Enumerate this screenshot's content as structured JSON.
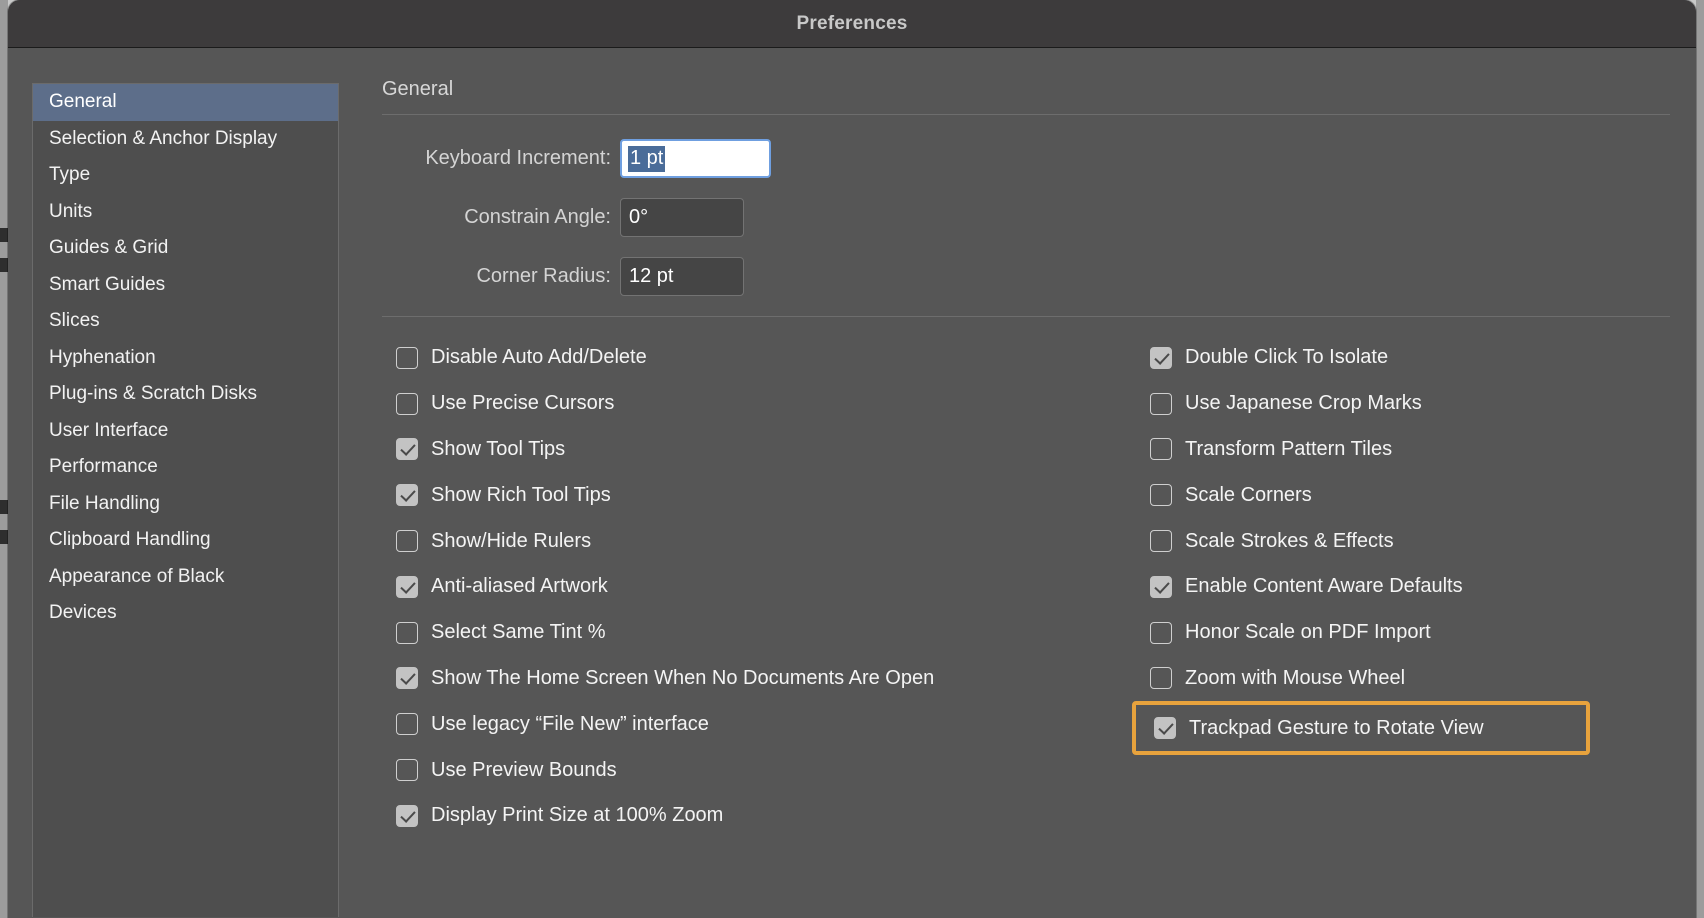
{
  "window": {
    "title": "Preferences"
  },
  "sidebar": {
    "items": [
      {
        "label": "General",
        "selected": true
      },
      {
        "label": "Selection & Anchor Display",
        "selected": false
      },
      {
        "label": "Type",
        "selected": false
      },
      {
        "label": "Units",
        "selected": false
      },
      {
        "label": "Guides & Grid",
        "selected": false
      },
      {
        "label": "Smart Guides",
        "selected": false
      },
      {
        "label": "Slices",
        "selected": false
      },
      {
        "label": "Hyphenation",
        "selected": false
      },
      {
        "label": "Plug-ins & Scratch Disks",
        "selected": false
      },
      {
        "label": "User Interface",
        "selected": false
      },
      {
        "label": "Performance",
        "selected": false
      },
      {
        "label": "File Handling",
        "selected": false
      },
      {
        "label": "Clipboard Handling",
        "selected": false
      },
      {
        "label": "Appearance of Black",
        "selected": false
      },
      {
        "label": "Devices",
        "selected": false
      }
    ]
  },
  "main": {
    "section_title": "General",
    "fields": [
      {
        "label": "Keyboard Increment:",
        "value": "1 pt",
        "focused": true,
        "selected_text": true
      },
      {
        "label": "Constrain Angle:",
        "value": "0°",
        "focused": false,
        "selected_text": false
      },
      {
        "label": "Corner Radius:",
        "value": "12 pt",
        "focused": false,
        "selected_text": false
      }
    ],
    "checkboxes_left": [
      {
        "label": "Disable Auto Add/Delete",
        "checked": false
      },
      {
        "label": "Use Precise Cursors",
        "checked": false
      },
      {
        "label": "Show Tool Tips",
        "checked": true
      },
      {
        "label": "Show Rich Tool Tips",
        "checked": true
      },
      {
        "label": "Show/Hide Rulers",
        "checked": false
      },
      {
        "label": "Anti-aliased Artwork",
        "checked": true
      },
      {
        "label": "Select Same Tint %",
        "checked": false
      },
      {
        "label": "Show The Home Screen When No Documents Are Open",
        "checked": true
      },
      {
        "label": "Use legacy “File New” interface",
        "checked": false
      },
      {
        "label": "Use Preview Bounds",
        "checked": false
      },
      {
        "label": "Display Print Size at 100% Zoom",
        "checked": true
      }
    ],
    "checkboxes_right": [
      {
        "label": "Double Click To Isolate",
        "checked": true
      },
      {
        "label": "Use Japanese Crop Marks",
        "checked": false
      },
      {
        "label": "Transform Pattern Tiles",
        "checked": false
      },
      {
        "label": "Scale Corners",
        "checked": false
      },
      {
        "label": "Scale Strokes & Effects",
        "checked": false
      },
      {
        "label": "Enable Content Aware Defaults",
        "checked": true
      },
      {
        "label": "Honor Scale on PDF Import",
        "checked": false
      },
      {
        "label": "Zoom with Mouse Wheel",
        "checked": false
      },
      {
        "label": "Trackpad Gesture to Rotate View",
        "checked": true,
        "highlighted": true
      }
    ]
  },
  "colors": {
    "highlight_ring": "#e8a33d",
    "selection_blue": "#5d6e8a",
    "text_selection": "#4a6c99",
    "focus_border": "#6f9fe0",
    "window_bg": "#565656",
    "titlebar_bg": "#3d3b3c"
  }
}
